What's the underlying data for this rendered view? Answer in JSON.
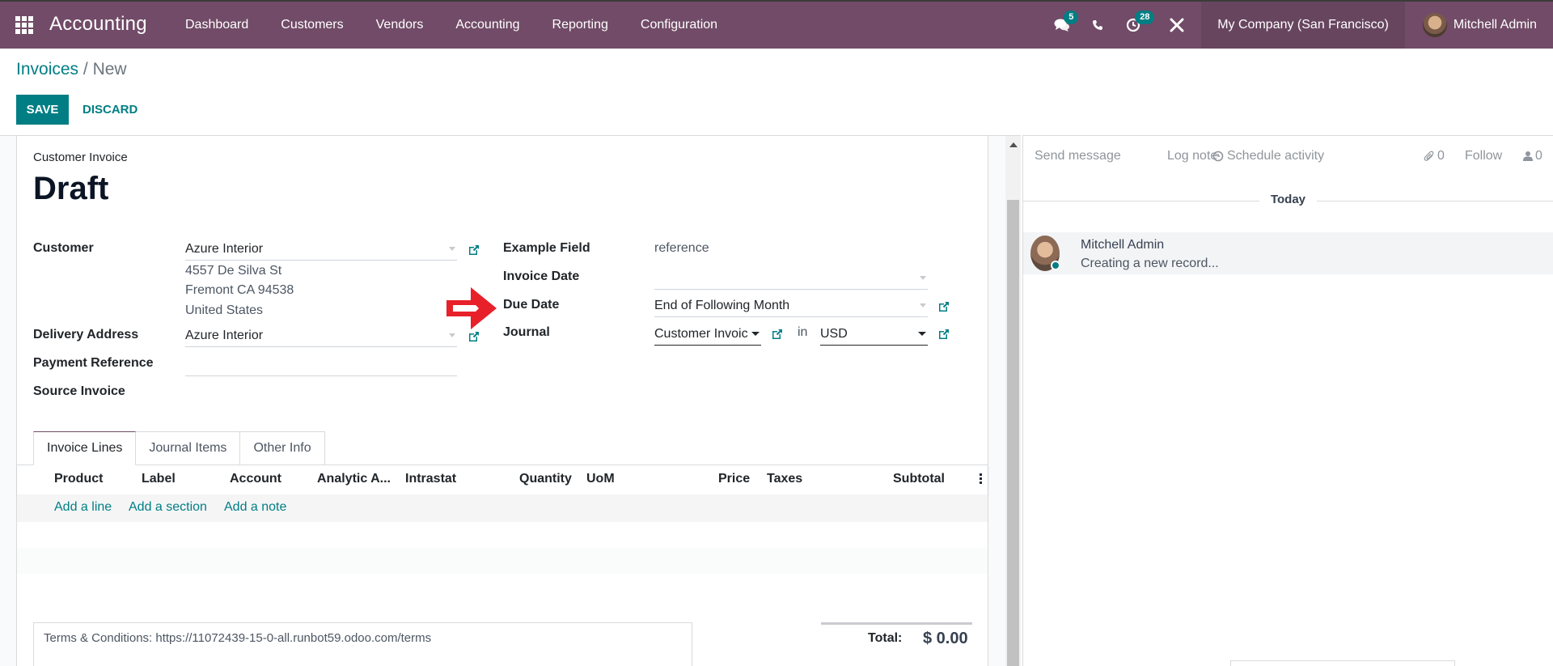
{
  "navbar": {
    "app_name": "Accounting",
    "apps_icon": "apps-grid-icon",
    "menu": [
      "Dashboard",
      "Customers",
      "Vendors",
      "Accounting",
      "Reporting",
      "Configuration"
    ],
    "messages_badge": "5",
    "activities_badge": "28",
    "company": "My Company (San Francisco)",
    "user": "Mitchell Admin"
  },
  "breadcrumb": {
    "parent": "Invoices",
    "separator": " / ",
    "current": "New"
  },
  "control": {
    "save_label": "SAVE",
    "discard_label": "DISCARD"
  },
  "form": {
    "doc_type": "Customer Invoice",
    "status_title": "Draft",
    "left": {
      "customer_label": "Customer",
      "customer_value": "Azure Interior",
      "address_lines": [
        "4557 De Silva St",
        "Fremont CA 94538",
        "United States"
      ],
      "delivery_label": "Delivery Address",
      "delivery_value": "Azure Interior",
      "payment_ref_label": "Payment Reference",
      "payment_ref_value": "",
      "source_invoice_label": "Source Invoice"
    },
    "right": {
      "example_label": "Example Field",
      "example_value": "reference",
      "invoice_date_label": "Invoice Date",
      "invoice_date_value": "",
      "due_date_label": "Due Date",
      "due_date_value": "End of Following Month",
      "journal_label": "Journal",
      "journal_value": "Customer Invoices",
      "journal_display": "Customer Invoic",
      "currency_connector": "in",
      "currency_value": "USD"
    },
    "annotation_arrow_color": "#e8202a"
  },
  "notebook": {
    "tabs": [
      "Invoice Lines",
      "Journal Items",
      "Other Info"
    ],
    "active_tab": "Invoice Lines",
    "columns": [
      "Product",
      "Label",
      "Account",
      "Analytic A...",
      "Intrastat",
      "Quantity",
      "UoM",
      "Price",
      "Taxes",
      "Subtotal"
    ],
    "add_links": [
      "Add a line",
      "Add a section",
      "Add a note"
    ]
  },
  "footer": {
    "terms": "Terms & Conditions: https://11072439-15-0-all.runbot59.odoo.com/terms",
    "total_label": "Total:",
    "total_value": "$ 0.00"
  },
  "chatter": {
    "send_message": "Send message",
    "log_note": "Log note",
    "schedule_activity": "Schedule activity",
    "attachments_count": "0",
    "follow": "Follow",
    "followers_count": "0",
    "date_separator": "Today",
    "messages": [
      {
        "author": "Mitchell Admin",
        "body": "Creating a new record..."
      }
    ]
  },
  "colors": {
    "brand": "#714b67",
    "accent": "#017e84",
    "company_bg": "#67455f"
  }
}
